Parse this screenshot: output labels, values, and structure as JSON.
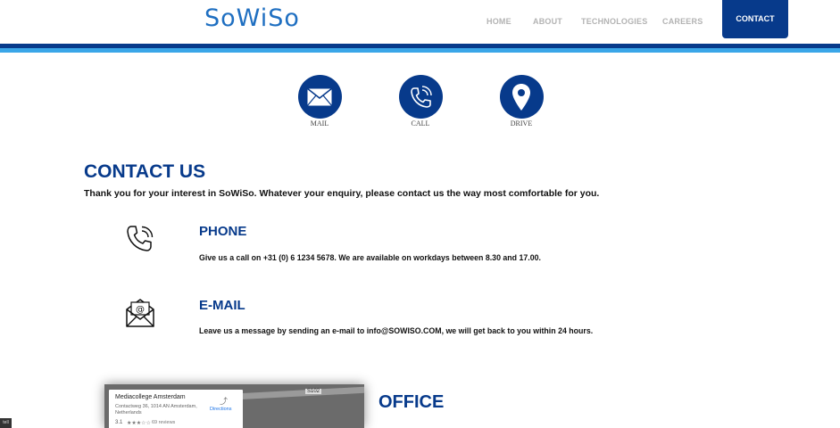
{
  "header": {
    "logo": "SoWiSo",
    "nav": [
      {
        "label": "HOME"
      },
      {
        "label": "ABOUT"
      },
      {
        "label": "TECHNOLOGIES"
      },
      {
        "label": "CAREERS"
      }
    ],
    "active_nav": "CONTACT"
  },
  "quick_links": [
    {
      "label": "MAIL",
      "icon": "envelope-icon"
    },
    {
      "label": "CALL",
      "icon": "phone-icon"
    },
    {
      "label": "DRIVE",
      "icon": "map-pin-icon"
    }
  ],
  "contact": {
    "title": "CONTACT US",
    "intro": "Thank you for your interest in SoWiSo. Whatever your enquiry, please contact us the way most comfortable for you."
  },
  "phone": {
    "title": "PHONE",
    "text": "Give us a call on +31 (0) 6 1234 5678. We are available on workdays between 8.30 and 17.00.",
    "icon": "phone-outline-icon"
  },
  "email": {
    "title": "E-MAIL",
    "text": "Leave us a message by sending an e-mail to info@SOWISO.COM, we will get back to you within 24 hours.",
    "icon": "email-at-outline-icon"
  },
  "map": {
    "place_name": "Mediacollege Amsterdam",
    "address": "Contactweg 36, 1014 AN Amsterdam, Netherlands",
    "rating": "3.1",
    "stars": "★★★☆☆",
    "reviews": "69 reviews",
    "directions_label": "Directions",
    "road_label": "S102"
  },
  "office": {
    "title": "OFFICE"
  },
  "corner_badge": "tell",
  "colors": {
    "brand_dark": "#073a8b",
    "brand_light": "#3aa6e8",
    "logo_blue": "#1f6fc1",
    "nav_grey": "#b3b3b3"
  }
}
